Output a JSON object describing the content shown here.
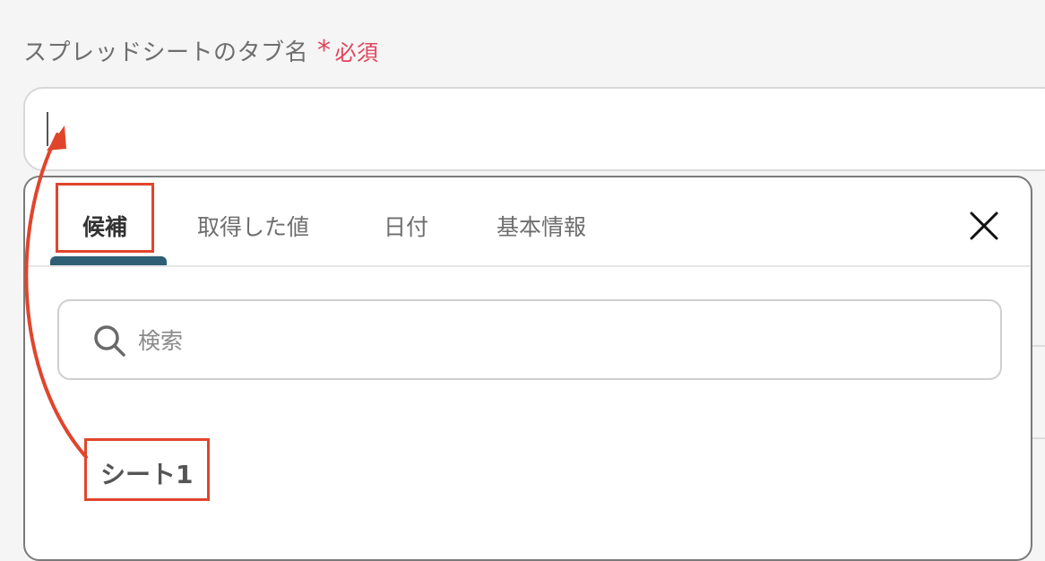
{
  "field": {
    "label": "スプレッドシートのタブ名",
    "required_mark": "*",
    "required_text": "必須",
    "value": ""
  },
  "popup": {
    "tabs": [
      {
        "label": "候補",
        "active": true
      },
      {
        "label": "取得した値",
        "active": false
      },
      {
        "label": "日付",
        "active": false
      },
      {
        "label": "基本情報",
        "active": false
      }
    ],
    "close_icon": "close-icon",
    "search": {
      "placeholder": "検索",
      "value": ""
    },
    "options": [
      "シート1"
    ]
  },
  "colors": {
    "required": "#e0455b",
    "accent_tab": "#2f5f74",
    "annotation": "#e0452c"
  }
}
